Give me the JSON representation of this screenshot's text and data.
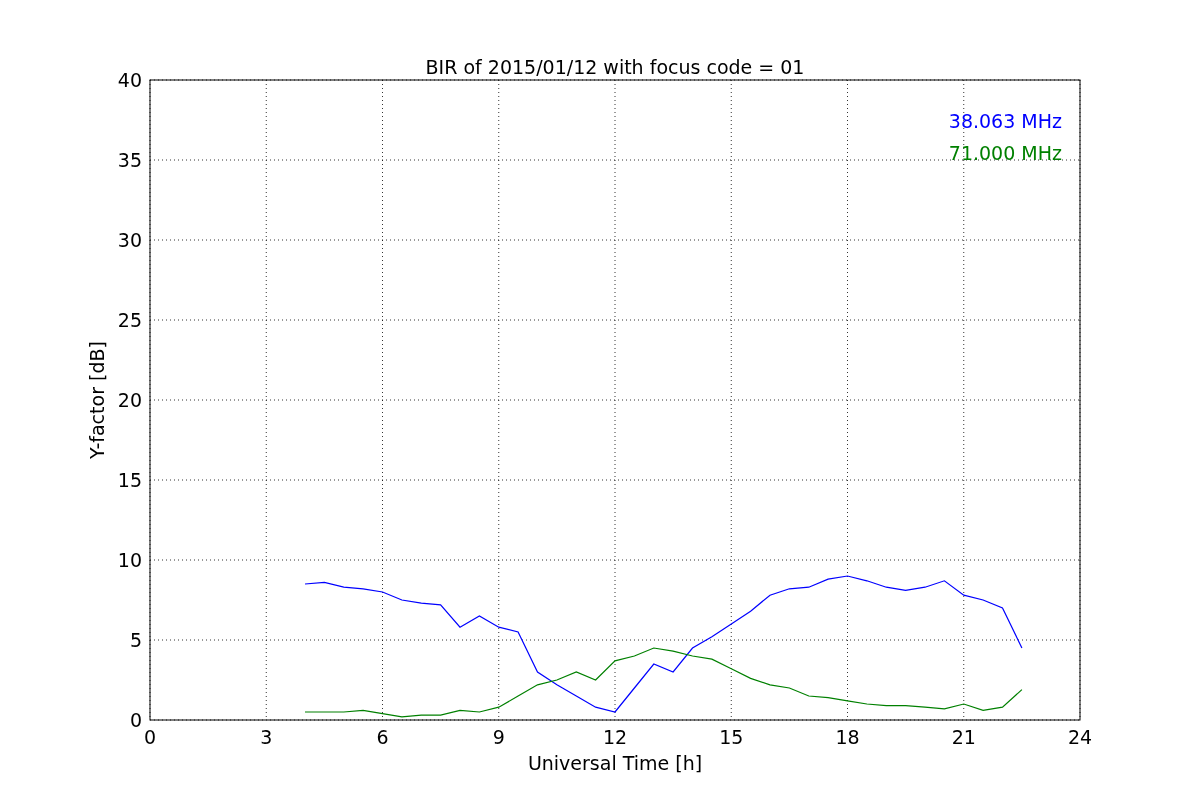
{
  "chart_data": {
    "type": "line",
    "title": "BIR of 2015/01/12 with focus code = 01",
    "xlabel": "Universal Time [h]",
    "ylabel": "Y-factor [dB]",
    "x": [
      4,
      4.5,
      5,
      5.5,
      6,
      6.5,
      7,
      7.5,
      8,
      8.5,
      9,
      9.5,
      10,
      10.5,
      11,
      11.5,
      12,
      12.5,
      13,
      13.5,
      14,
      14.5,
      15,
      15.5,
      16,
      16.5,
      17,
      17.5,
      18,
      18.5,
      19,
      19.5,
      20,
      20.5,
      21,
      21.5,
      22,
      22.5
    ],
    "series": [
      {
        "name": "38.063 MHz",
        "color": "#0000ff",
        "values": [
          8.5,
          8.6,
          8.3,
          8.2,
          8.0,
          7.5,
          7.3,
          7.2,
          5.8,
          6.5,
          5.8,
          5.5,
          3.0,
          2.2,
          1.5,
          0.8,
          0.5,
          2.0,
          3.5,
          3.0,
          4.5,
          5.2,
          6.0,
          6.8,
          7.8,
          8.2,
          8.3,
          8.8,
          9.0,
          8.7,
          8.3,
          8.1,
          8.3,
          8.7,
          7.8,
          7.5,
          7.0,
          4.5
        ]
      },
      {
        "name": "71.000 MHz",
        "color": "#008000",
        "values": [
          0.5,
          0.5,
          0.5,
          0.6,
          0.4,
          0.2,
          0.3,
          0.3,
          0.6,
          0.5,
          0.8,
          1.5,
          2.2,
          2.5,
          3.0,
          2.5,
          3.7,
          4.0,
          4.5,
          4.3,
          4.0,
          3.8,
          3.2,
          2.6,
          2.2,
          2.0,
          1.5,
          1.4,
          1.2,
          1.0,
          0.9,
          0.9,
          0.8,
          0.7,
          1.0,
          0.6,
          0.8,
          1.9
        ]
      }
    ],
    "grid": true,
    "xlim": [
      0,
      24
    ],
    "ylim": [
      0,
      40
    ],
    "xticks": [
      0,
      3,
      6,
      9,
      12,
      15,
      18,
      21,
      24
    ],
    "yticks": [
      0,
      5,
      10,
      15,
      20,
      25,
      30,
      35,
      40
    ]
  }
}
